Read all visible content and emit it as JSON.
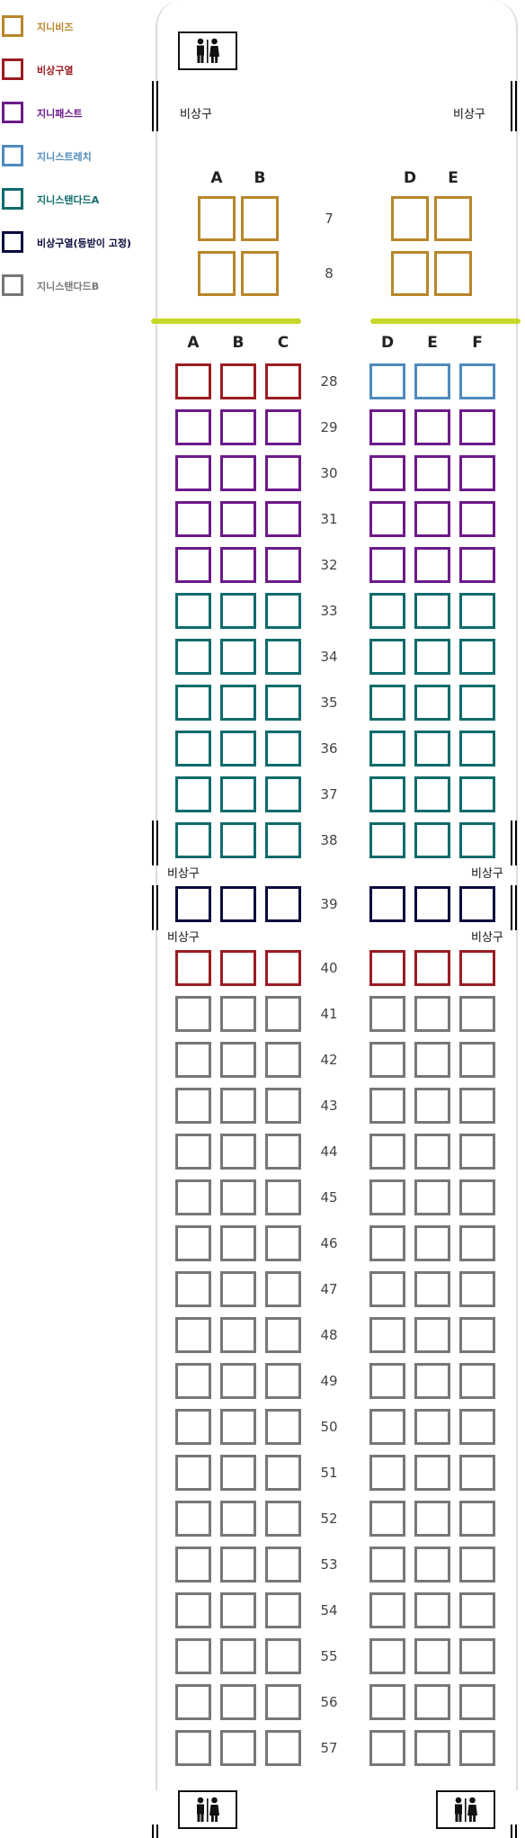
{
  "colors": {
    "first": "#b8862b",
    "exit": "#9b1c23",
    "fast": "#6d1a8a",
    "stretch": "#4f8bbd",
    "standardA": "#0f6b6b",
    "exitFixed": "#0a0a3e",
    "standardB": "#777777",
    "divider": "#c8d82a"
  },
  "legend": [
    {
      "key": "first",
      "label": "지니비즈",
      "color": "#b8862b"
    },
    {
      "key": "exit",
      "label": "비상구열",
      "color": "#9b1c23"
    },
    {
      "key": "fast",
      "label": "지니패스트",
      "color": "#6d1a8a"
    },
    {
      "key": "stretch",
      "label": "지니스트레치",
      "color": "#4f8bbd"
    },
    {
      "key": "standardA",
      "label": "지니스탠다드A",
      "color": "#0f6b6b"
    },
    {
      "key": "exitFixed",
      "label": "비상구열(등받이 고정)",
      "color": "#0a0a3e"
    },
    {
      "key": "standardB",
      "label": "지니스탠다드B",
      "color": "#777777"
    }
  ],
  "exit_text": "비상구",
  "toilet_icon": "restroom-icon",
  "first_class": {
    "columns": [
      "A",
      "B",
      "D",
      "E"
    ],
    "rows": [
      "7",
      "8"
    ]
  },
  "economy": {
    "columns": [
      "A",
      "B",
      "C",
      "D",
      "E",
      "F"
    ],
    "rows": [
      {
        "row": "28",
        "left": "exit",
        "right": "stretch"
      },
      {
        "row": "29",
        "left": "fast",
        "right": "fast"
      },
      {
        "row": "30",
        "left": "fast",
        "right": "fast"
      },
      {
        "row": "31",
        "left": "fast",
        "right": "fast"
      },
      {
        "row": "32",
        "left": "fast",
        "right": "fast"
      },
      {
        "row": "33",
        "left": "standardA",
        "right": "standardA"
      },
      {
        "row": "34",
        "left": "standardA",
        "right": "standardA"
      },
      {
        "row": "35",
        "left": "standardA",
        "right": "standardA"
      },
      {
        "row": "36",
        "left": "standardA",
        "right": "standardA"
      },
      {
        "row": "37",
        "left": "standardA",
        "right": "standardA"
      },
      {
        "row": "38",
        "left": "standardA",
        "right": "standardA"
      },
      {
        "row": "39",
        "left": "exitFixed",
        "right": "exitFixed"
      },
      {
        "row": "40",
        "left": "exit",
        "right": "exit"
      },
      {
        "row": "41",
        "left": "standardB",
        "right": "standardB"
      },
      {
        "row": "42",
        "left": "standardB",
        "right": "standardB"
      },
      {
        "row": "43",
        "left": "standardB",
        "right": "standardB"
      },
      {
        "row": "44",
        "left": "standardB",
        "right": "standardB"
      },
      {
        "row": "45",
        "left": "standardB",
        "right": "standardB"
      },
      {
        "row": "46",
        "left": "standardB",
        "right": "standardB"
      },
      {
        "row": "47",
        "left": "standardB",
        "right": "standardB"
      },
      {
        "row": "48",
        "left": "standardB",
        "right": "standardB"
      },
      {
        "row": "49",
        "left": "standardB",
        "right": "standardB"
      },
      {
        "row": "50",
        "left": "standardB",
        "right": "standardB"
      },
      {
        "row": "51",
        "left": "standardB",
        "right": "standardB"
      },
      {
        "row": "52",
        "left": "standardB",
        "right": "standardB"
      },
      {
        "row": "53",
        "left": "standardB",
        "right": "standardB"
      },
      {
        "row": "54",
        "left": "standardB",
        "right": "standardB"
      },
      {
        "row": "55",
        "left": "standardB",
        "right": "standardB"
      },
      {
        "row": "56",
        "left": "standardB",
        "right": "standardB"
      },
      {
        "row": "57",
        "left": "standardB",
        "right": "standardB"
      }
    ]
  }
}
